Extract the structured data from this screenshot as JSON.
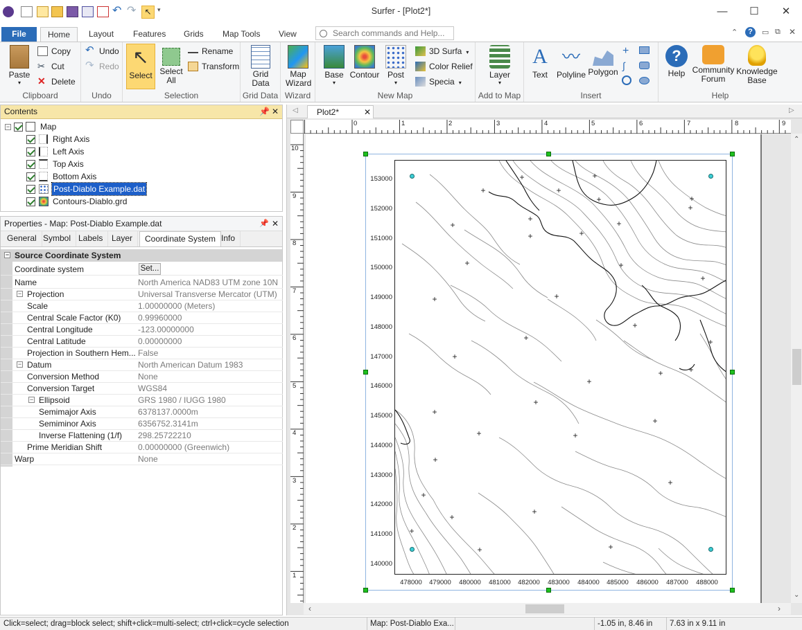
{
  "app": {
    "title": "Surfer - [Plot2*]"
  },
  "ribbon": {
    "tabs": [
      "File",
      "Home",
      "Layout",
      "Features",
      "Grids",
      "Map Tools",
      "View"
    ],
    "search_placeholder": "Search commands and Help...",
    "clipboard": {
      "paste": "Paste",
      "copy": "Copy",
      "cut": "Cut",
      "delete": "Delete",
      "label": "Clipboard"
    },
    "undo": {
      "undo": "Undo",
      "redo": "Redo",
      "label": "Undo"
    },
    "selection": {
      "select": "Select",
      "select_all": "Select All",
      "rename": "Rename",
      "transform": "Transform",
      "label": "Selection"
    },
    "grid_data": {
      "grid": "Grid Data",
      "label": "Grid Data"
    },
    "wizard": {
      "map_wizard": "Map Wizard",
      "label": "Wizard"
    },
    "new_map": {
      "base": "Base",
      "contour": "Contour",
      "post": "Post",
      "surface3d": "3D Surfa",
      "color_relief": "Color Relief",
      "specialty": "Specia",
      "label": "New Map"
    },
    "add_to_map": {
      "layer": "Layer",
      "label": "Add to Map"
    },
    "insert": {
      "text": "Text",
      "polyline": "Polyline",
      "polygon": "Polygon",
      "label": "Insert"
    },
    "help": {
      "help": "Help",
      "community": "Community Forum",
      "kb": "Knowledge Base",
      "label": "Help"
    }
  },
  "contents": {
    "title": "Contents",
    "items": [
      {
        "label": "Map",
        "checked": true
      },
      {
        "label": "Right Axis",
        "checked": true
      },
      {
        "label": "Left Axis",
        "checked": true
      },
      {
        "label": "Top Axis",
        "checked": true
      },
      {
        "label": "Bottom Axis",
        "checked": true
      },
      {
        "label": "Post-Diablo Example.dat",
        "checked": true
      },
      {
        "label": "Contours-Diablo.grd",
        "checked": true
      }
    ]
  },
  "properties": {
    "title": "Properties - Map: Post-Diablo Example.dat",
    "tabs": [
      "General",
      "Symbol",
      "Labels",
      "Layer",
      "Coordinate System",
      "Info"
    ],
    "section": "Source Coordinate System",
    "rows": [
      {
        "k": "Coordinate system",
        "v": "Set..."
      },
      {
        "k": "Name",
        "v": "North America NAD83 UTM zone 10N"
      },
      {
        "k": "Projection",
        "v": "Universal Transverse Mercator (UTM)"
      },
      {
        "k": "Scale",
        "v": "1.00000000 (Meters)"
      },
      {
        "k": "Central Scale Factor (K0)",
        "v": "0.99960000"
      },
      {
        "k": "Central Longitude",
        "v": "-123.00000000"
      },
      {
        "k": "Central Latitude",
        "v": "0.00000000"
      },
      {
        "k": "Projection in Southern Hem...",
        "v": "False"
      },
      {
        "k": "Datum",
        "v": "North American Datum 1983"
      },
      {
        "k": "Conversion Method",
        "v": "None"
      },
      {
        "k": "Conversion Target",
        "v": "WGS84"
      },
      {
        "k": "Ellipsoid",
        "v": "GRS 1980 / IUGG 1980"
      },
      {
        "k": "Semimajor Axis",
        "v": "6378137.0000m"
      },
      {
        "k": "Semiminor Axis",
        "v": "6356752.3141m"
      },
      {
        "k": "Inverse Flattening (1/f)",
        "v": "298.25722210"
      },
      {
        "k": "Prime Meridian Shift",
        "v": "0.00000000 (Greenwich)"
      },
      {
        "k": "Warp",
        "v": "None"
      }
    ]
  },
  "doc": {
    "tab": "Plot2*"
  },
  "ruler": {
    "top": [
      "0",
      "1",
      "2",
      "3",
      "4",
      "5",
      "6",
      "7",
      "8",
      "9"
    ],
    "left": [
      "10",
      "9",
      "8",
      "7",
      "6",
      "5",
      "4",
      "3",
      "2",
      "1"
    ]
  },
  "map": {
    "y_labels": [
      "153000",
      "152000",
      "151000",
      "150000",
      "149000",
      "148000",
      "147000",
      "146000",
      "145000",
      "144000",
      "143000",
      "142000",
      "141000",
      "140000"
    ],
    "x_labels": [
      "478000",
      "479000",
      "480000",
      "481000",
      "482000",
      "483000",
      "484000",
      "485000",
      "486000",
      "487000",
      "488000"
    ]
  },
  "status": {
    "hint": "Click=select; drag=block select; shift+click=multi-select; ctrl+click=cycle selection",
    "selection": "Map: Post-Diablo Exa...",
    "cursor": "-1.05 in, 8.46 in",
    "size": "7.63 in x 9.11 in"
  }
}
